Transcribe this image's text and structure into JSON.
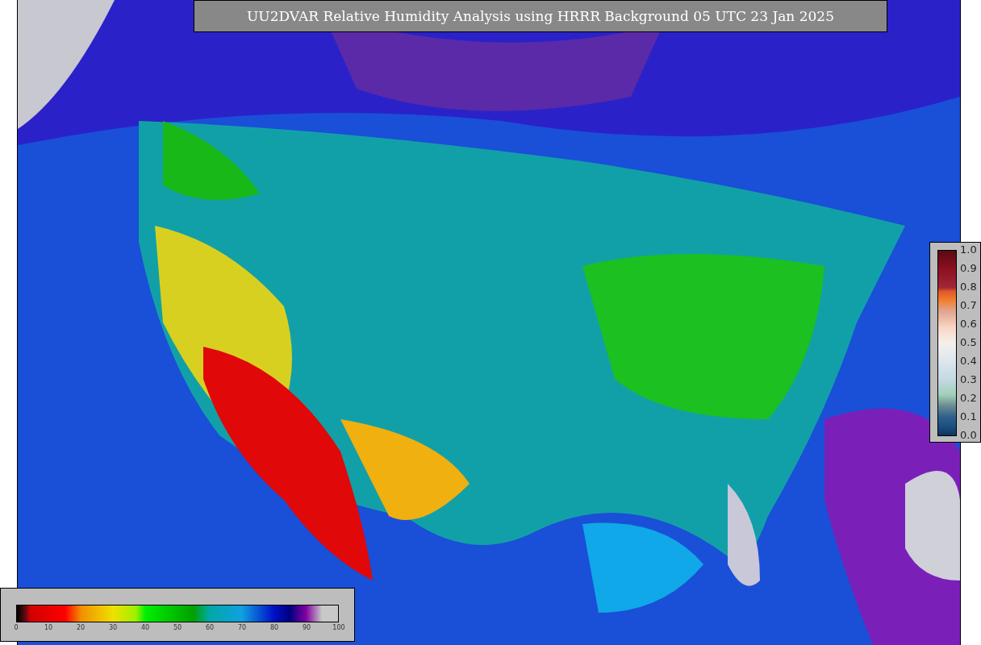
{
  "title": "UU2DVAR Relative Humidity Analysis using HRRR Background 05 UTC 23 Jan 2025",
  "observation_scale": {
    "ticks": [
      "1.0",
      "0.9",
      "0.8",
      "0.7",
      "0.6",
      "0.5",
      "0.4",
      "0.3",
      "0.2",
      "0.1",
      "0.0"
    ]
  },
  "humidity_scale": {
    "ticks": [
      "0",
      "10",
      "20",
      "30",
      "40",
      "50",
      "60",
      "70",
      "80",
      "90",
      "100"
    ]
  }
}
